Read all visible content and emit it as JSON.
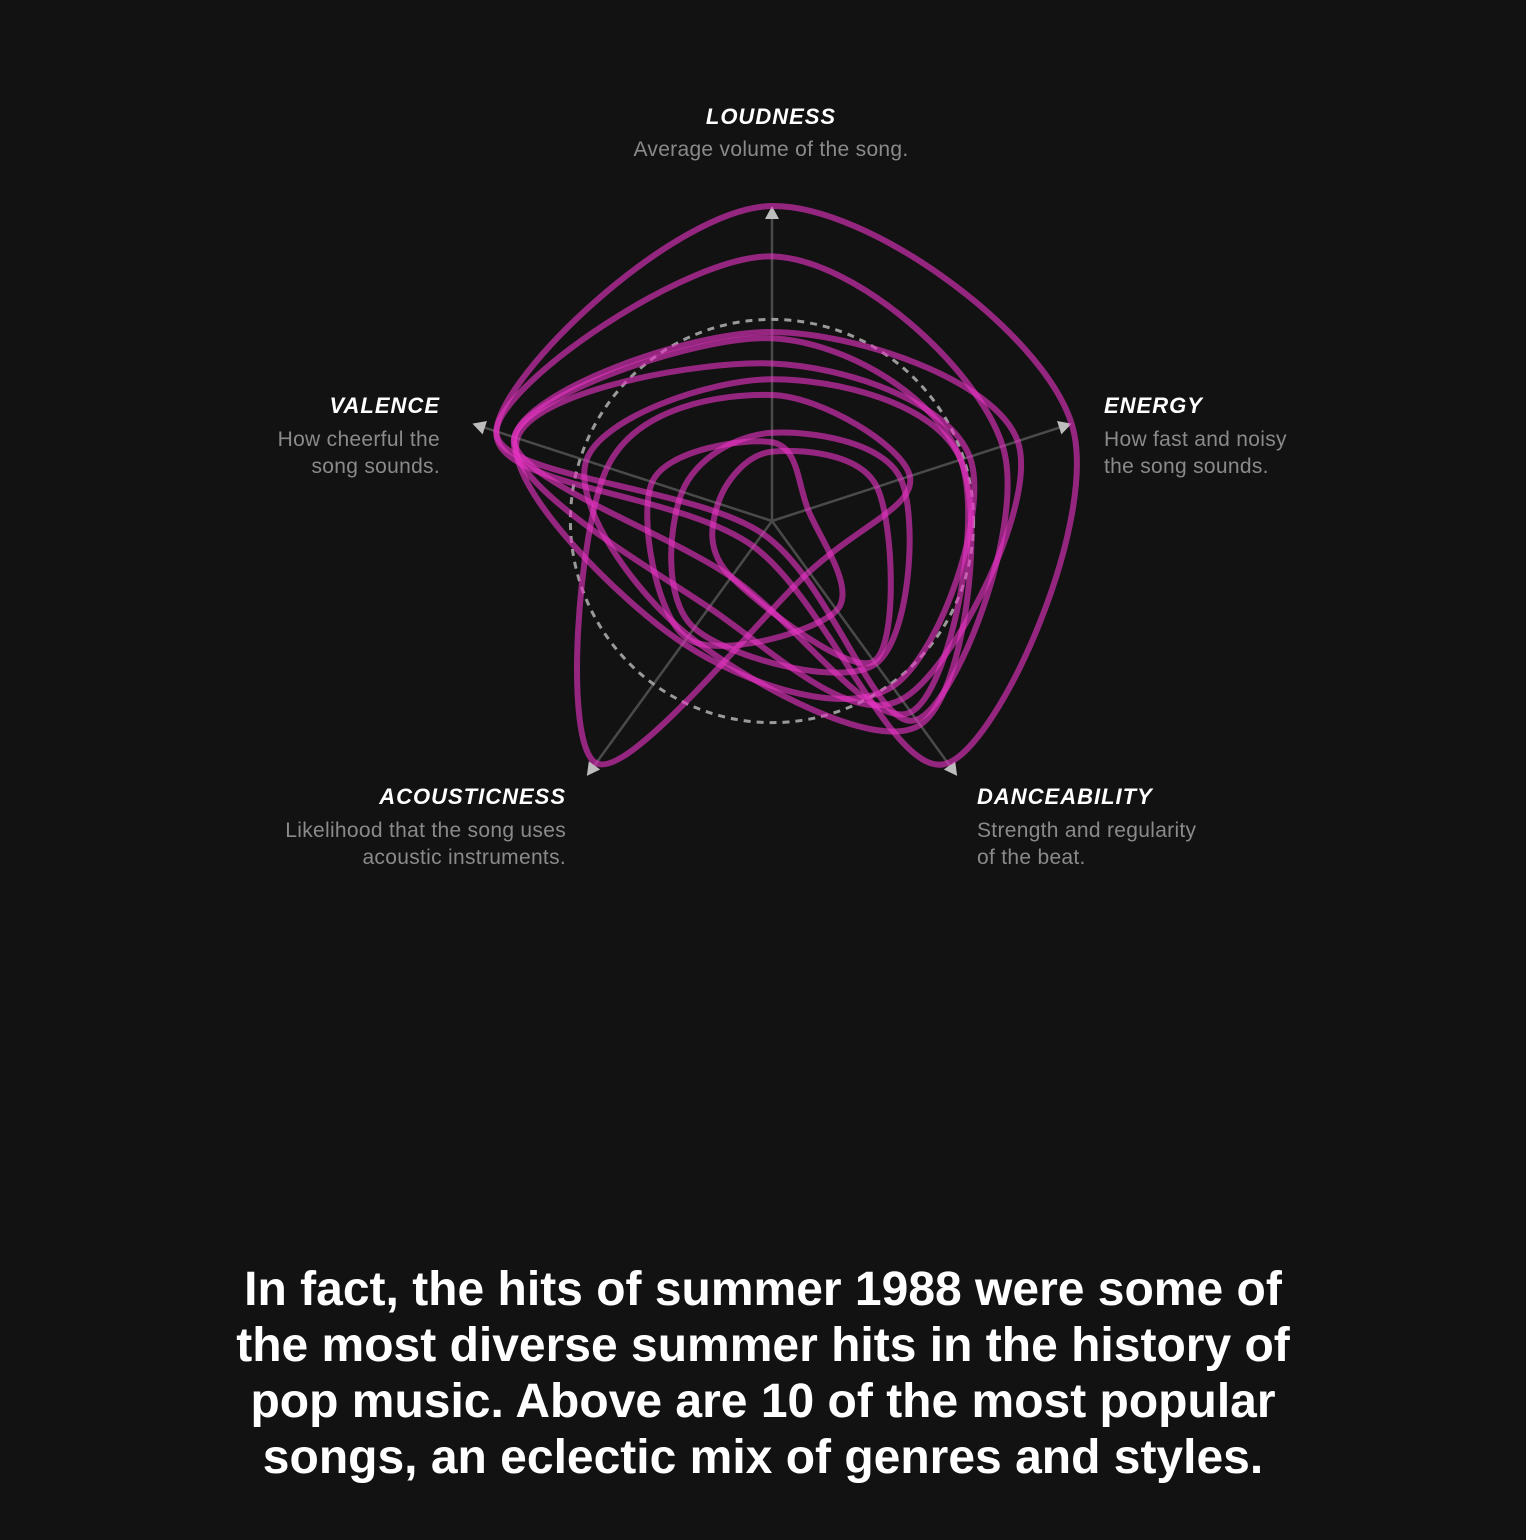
{
  "chart_data": {
    "type": "radar",
    "axes": [
      {
        "name": "LOUDNESS",
        "description": "Average volume of the song."
      },
      {
        "name": "ENERGY",
        "description": "How fast and noisy\nthe song sounds."
      },
      {
        "name": "DANCEABILITY",
        "description": "Strength and regularity\nof the beat."
      },
      {
        "name": "ACOUSTICNESS",
        "description": "Likelihood that the song uses\nacoustic instruments."
      },
      {
        "name": "VALENCE",
        "description": "How cheerful the\nsong sounds."
      }
    ],
    "reference_level": 0.64,
    "range": [
      0,
      1
    ],
    "series_color": "#e633c4",
    "axis_color": "#4a4a4a",
    "reference_color": "#9a9a9a",
    "series": [
      {
        "values": [
          1.0,
          1.0,
          0.95,
          0.1,
          0.92
        ]
      },
      {
        "values": [
          0.84,
          0.77,
          0.78,
          0.05,
          0.92
        ]
      },
      {
        "values": [
          0.58,
          0.63,
          0.75,
          0.22,
          0.86
        ]
      },
      {
        "values": [
          0.6,
          0.82,
          0.7,
          0.34,
          0.86
        ]
      },
      {
        "values": [
          0.5,
          0.66,
          0.65,
          0.48,
          0.85
        ]
      },
      {
        "values": [
          0.45,
          0.63,
          0.8,
          0.45,
          0.62
        ]
      },
      {
        "values": [
          0.4,
          0.46,
          0.2,
          0.95,
          0.55
        ]
      },
      {
        "values": [
          0.25,
          0.12,
          0.35,
          0.46,
          0.4
        ]
      },
      {
        "values": [
          0.22,
          0.35,
          0.55,
          0.22,
          0.18
        ]
      },
      {
        "values": [
          0.28,
          0.43,
          0.56,
          0.42,
          0.3
        ]
      }
    ]
  },
  "caption": "In fact, the hits of summer 1988 were some of the most diverse summer hits in the history of pop music. Above are 10 of the most popular songs, an eclectic mix of genres and styles."
}
